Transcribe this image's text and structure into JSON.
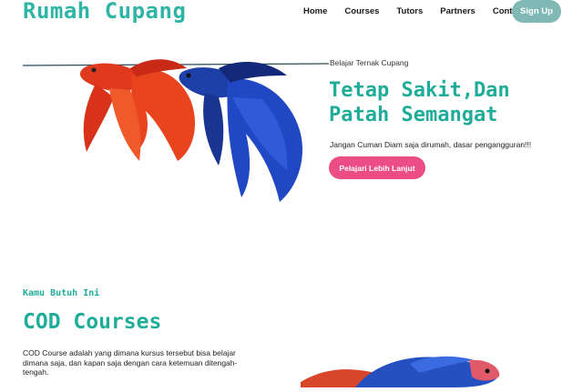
{
  "header": {
    "brand": "Rumah Cupang",
    "nav": [
      "Home",
      "Courses",
      "Tutors",
      "Partners",
      "Contact"
    ],
    "signup_label": "Sign Up"
  },
  "hero": {
    "eyebrow": "Belajar Ternak Cupang",
    "headline": "Tetap Sakit,Dan Patah Semangat",
    "tagline": "Jangan Cuman Diam saja dirumah, dasar pengangguran!!!",
    "cta_label": "Pelajari Lebih Lanjut",
    "image": "two-betta-fish-red-and-blue"
  },
  "courses": {
    "eyebrow": "Kamu Butuh Ini",
    "title": "COD Courses",
    "description": "COD Course adalah yang dimana kursus tersebut bisa belajar dimana saja, dan kapan saja dengan cara ketemuan ditengah-tengah.",
    "image": "betta-fish-blue-red"
  },
  "colors": {
    "brand": "#2fb5a5",
    "signup": "#7fb8b5",
    "cta": "#ec4d85"
  }
}
